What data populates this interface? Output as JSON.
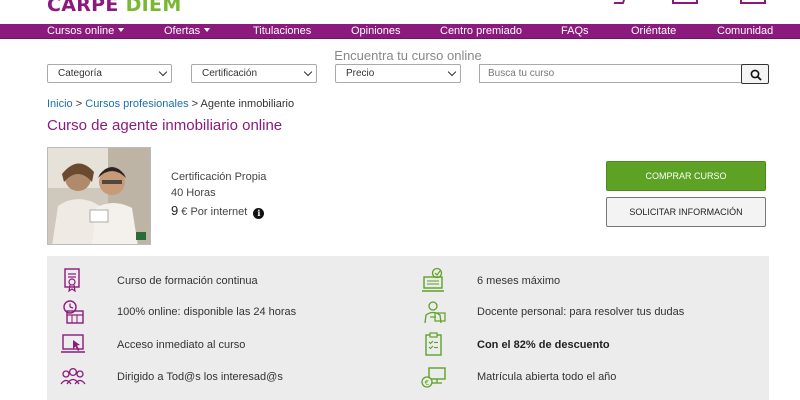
{
  "header": {
    "logo_word1": "CARPE",
    "logo_word2": "DIEM"
  },
  "nav": {
    "items": [
      {
        "label": "Cursos online",
        "dropdown": true
      },
      {
        "label": "Ofertas",
        "dropdown": true
      },
      {
        "label": "Titulaciones",
        "dropdown": false
      },
      {
        "label": "Opiniones",
        "dropdown": false
      },
      {
        "label": "Centro premiado",
        "dropdown": false
      },
      {
        "label": "FAQs",
        "dropdown": false
      },
      {
        "label": "Oriéntate",
        "dropdown": false
      },
      {
        "label": "Comunidad",
        "dropdown": false
      }
    ]
  },
  "search": {
    "title": "Encuentra tu curso online",
    "filters": [
      "Categoría",
      "Certificación",
      "Precio"
    ],
    "placeholder": "Busca tu curso"
  },
  "breadcrumb": {
    "home": "Inicio",
    "separator": ">",
    "section": "Cursos profesionales",
    "current": "Agente inmobiliario"
  },
  "page_title": "Curso de agente inmobiliario online",
  "product": {
    "certification": "Certificación Propia",
    "hours": "40 Horas",
    "price_amount": "9",
    "price_suffix": "€ Por internet",
    "info_icon": "i"
  },
  "buttons": {
    "buy": "COMPRAR CURSO",
    "request_info": "SOLICITAR INFORMACIÓN"
  },
  "features": {
    "left": [
      {
        "icon": "certificate-icon",
        "text": "Curso de formación continua"
      },
      {
        "icon": "calendar-clock-icon",
        "text": "100% online: disponible las 24 horas"
      },
      {
        "icon": "laptop-click-icon",
        "text": "Acceso inmediato al curso"
      },
      {
        "icon": "group-icon",
        "text": "Dirigido a Tod@s los interesad@s"
      }
    ],
    "right": [
      {
        "icon": "computer-clock-icon",
        "text": "6 meses máximo",
        "bold": false
      },
      {
        "icon": "teacher-icon",
        "text": "Docente personal: para resolver tus dudas",
        "bold": false
      },
      {
        "icon": "checklist-icon",
        "text": "Con el 82% de descuento",
        "bold": true
      },
      {
        "icon": "enrollment-computer-icon",
        "text": "Matrícula abierta todo el año",
        "bold": false
      }
    ]
  },
  "colors": {
    "brand_purple": "#8c1a7c",
    "brand_green": "#78b833",
    "buy_button": "#5da224",
    "features_bg": "#ececec"
  }
}
